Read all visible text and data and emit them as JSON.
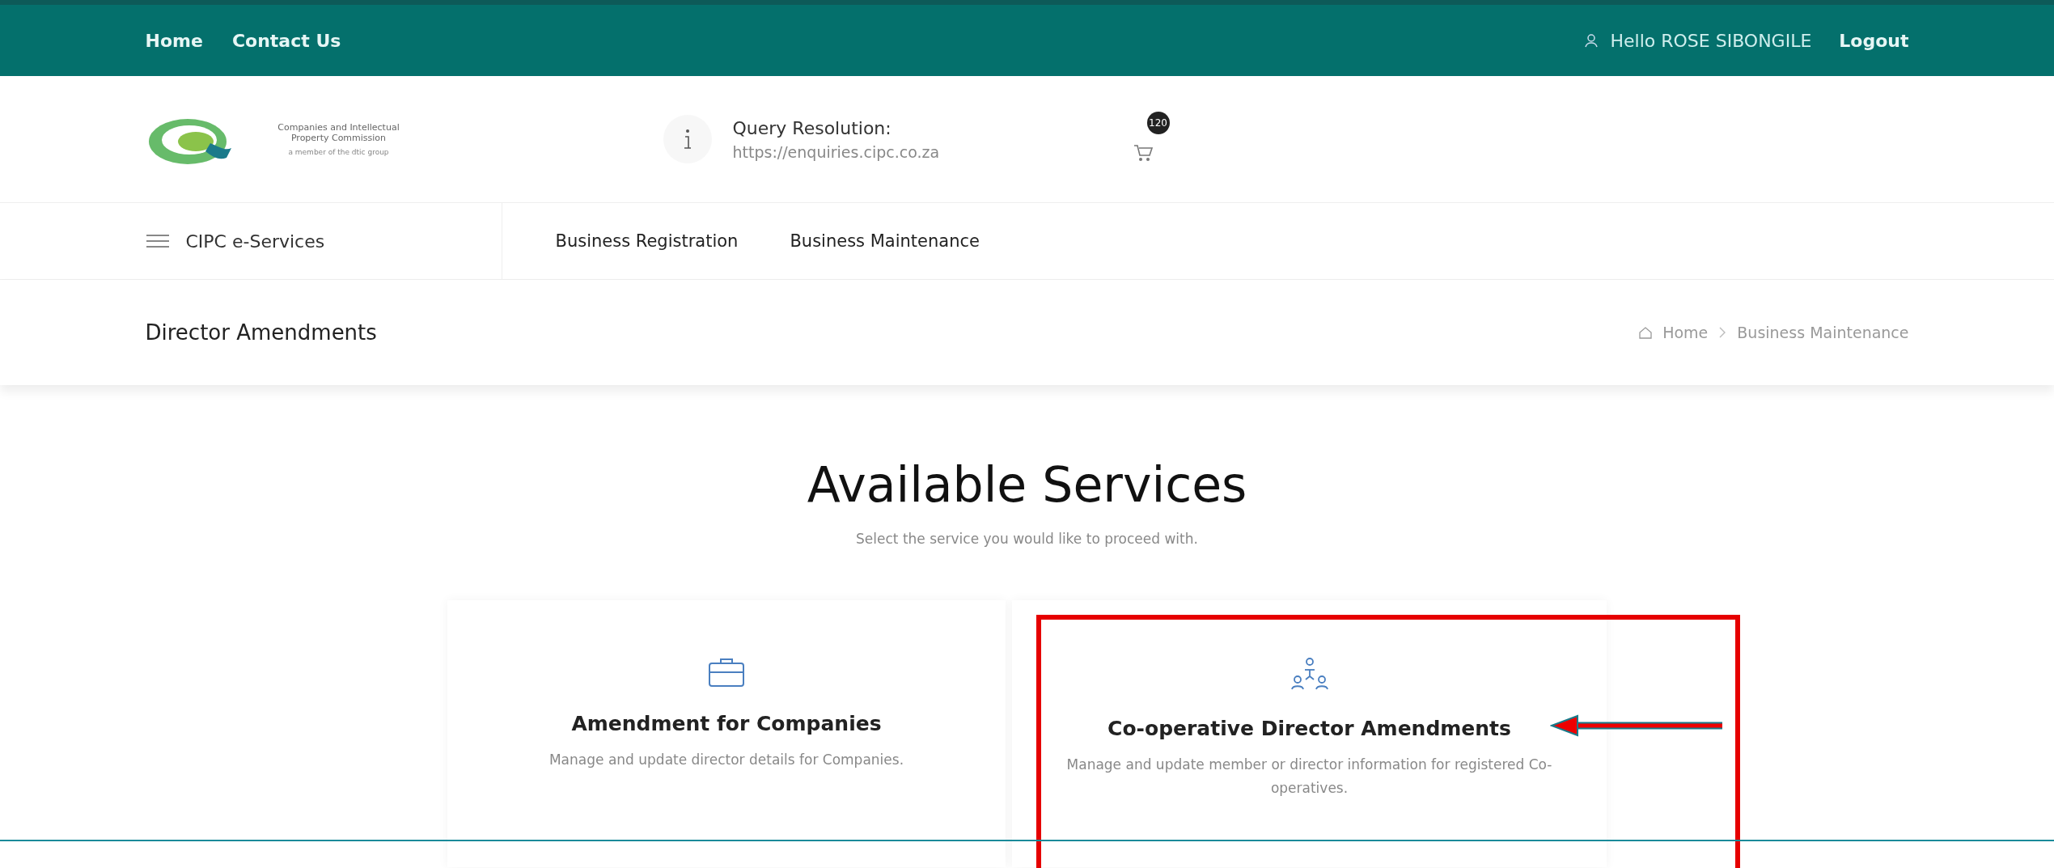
{
  "top_bar": {
    "links": [
      "Home",
      "Contact Us"
    ],
    "greeting": "Hello ROSE SIBONGILE",
    "logout": "Logout"
  },
  "header": {
    "logo_name": "Companies and Intellectual Property Commission",
    "logo_tagline": "a member of the dtic group",
    "query_title": "Query Resolution:",
    "query_url": "https://enquiries.cipc.co.za",
    "cart_count": "120"
  },
  "nav": {
    "menu": "CIPC e-Services",
    "items": [
      "Business Registration",
      "Business Maintenance"
    ]
  },
  "page_title": "Director Amendments",
  "breadcrumb": [
    "Home",
    "Business Maintenance"
  ],
  "heading": "Available Services",
  "subheading": "Select the service you would like to proceed with.",
  "cards": [
    {
      "kind": "briefcase",
      "title": "Amendment for Companies",
      "description": "Manage and update director details for Companies.",
      "highlighted": false
    },
    {
      "kind": "people",
      "title": "Co-operative Director Amendments",
      "description": "Manage and update member or director information for registered Co-operatives.",
      "highlighted": true
    }
  ]
}
